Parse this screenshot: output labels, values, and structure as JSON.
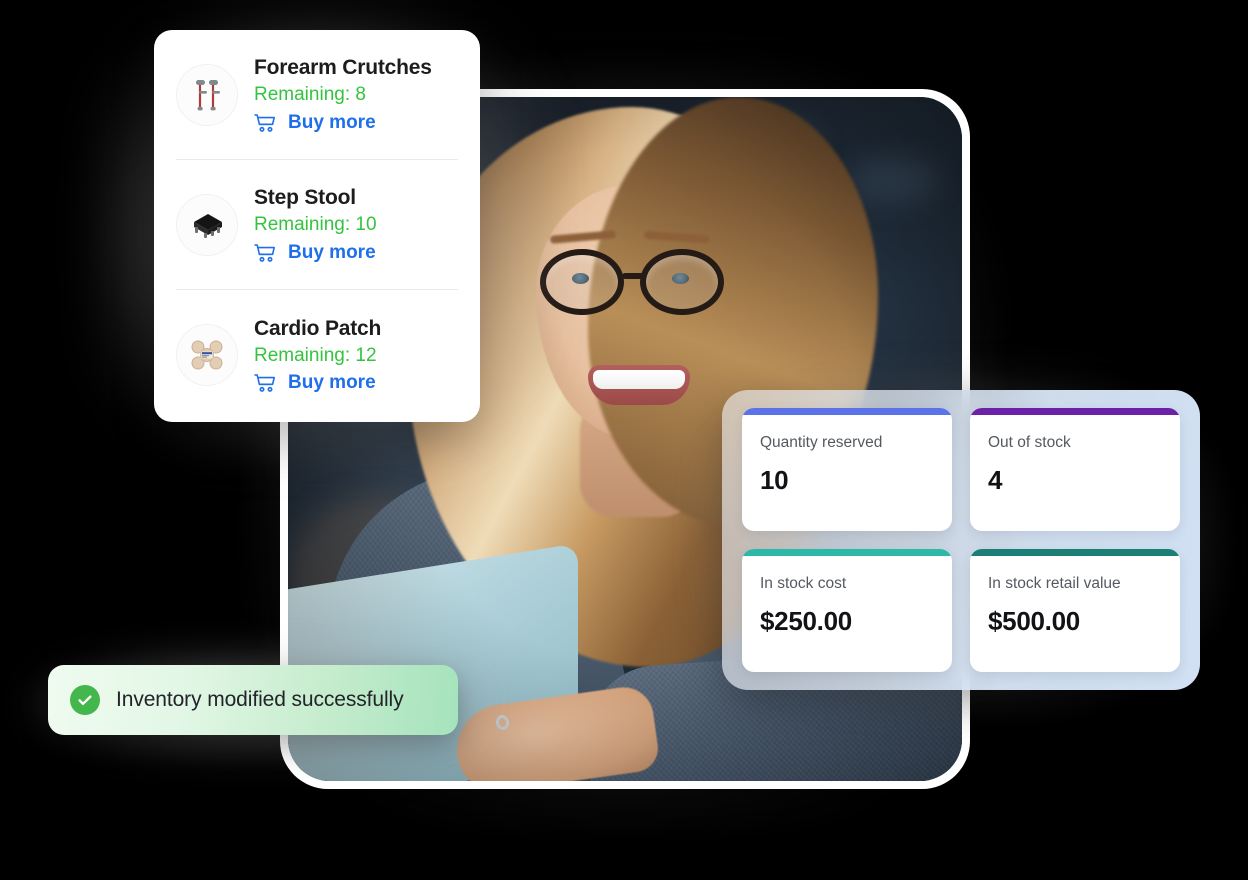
{
  "products": {
    "items": [
      {
        "name": "Forearm Crutches",
        "remaining_label": "Remaining: 8",
        "remaining_count": 8,
        "buy_label": "Buy more",
        "icon": "forearm-crutches-thumbnail"
      },
      {
        "name": "Step Stool",
        "remaining_label": "Remaining: 10",
        "remaining_count": 10,
        "buy_label": "Buy more",
        "icon": "step-stool-thumbnail"
      },
      {
        "name": "Cardio Patch",
        "remaining_label": "Remaining: 12",
        "remaining_count": 12,
        "buy_label": "Buy more",
        "icon": "cardio-patch-thumbnail"
      }
    ],
    "cart_icon": "shopping-cart-icon"
  },
  "stats": {
    "cards": [
      {
        "label": "Quantity reserved",
        "value": "10",
        "accent": "#5b72e8"
      },
      {
        "label": "Out of stock",
        "value": "4",
        "accent": "#6b21a8"
      },
      {
        "label": "In stock cost",
        "value": "$250.00",
        "accent": "#2db8a8"
      },
      {
        "label": "In stock retail value",
        "value": "$500.00",
        "accent": "#1b7f76"
      }
    ]
  },
  "toast": {
    "message": "Inventory modified successfully",
    "icon": "success-check-icon",
    "icon_color": "#43b64c"
  },
  "hero": {
    "alt": "smiling-woman-with-glasses-at-laptop"
  },
  "colors": {
    "page_background": "#000000",
    "remaining_green": "#35c33f",
    "link_blue": "#1f6feb",
    "card_white": "#ffffff",
    "stats_panel_blue": "#d8e8fb"
  }
}
